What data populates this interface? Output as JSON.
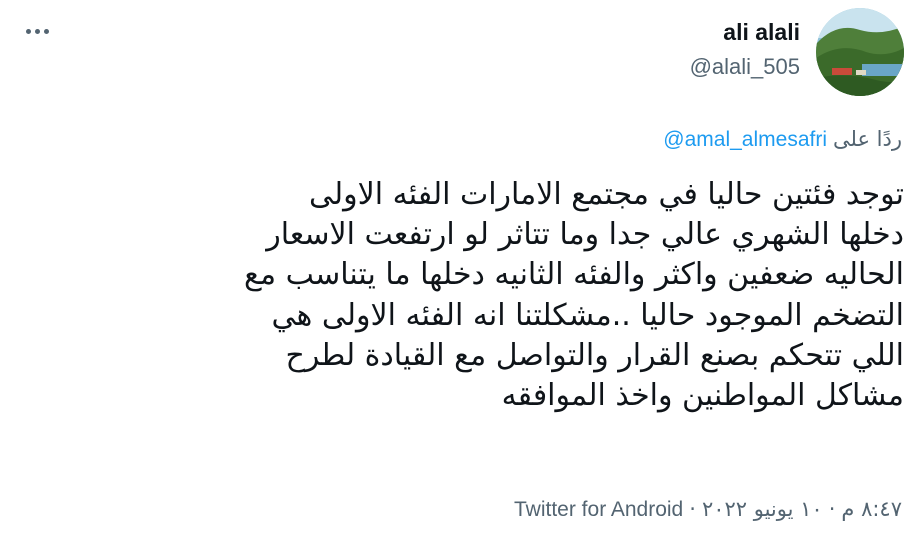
{
  "user": {
    "display_name": "ali alali",
    "handle": "@alali_505"
  },
  "reply": {
    "label": "ردًا على",
    "mention": "@amal_almesafri"
  },
  "tweet": {
    "lines": [
      "توجد فئتين حاليا في مجتمع الامارات الفئه الاولى",
      "دخلها الشهري عالي جدا وما تتاثر لو ارتفعت الاسعار",
      "الحاليه ضعفين واكثر والفئه الثانيه دخلها ما يتناسب مع",
      "التضخم الموجود حاليا ..مشكلتنا انه الفئه الاولى هي",
      "اللي تتحكم بصنع القرار والتواصل مع القيادة لطرح",
      "مشاكل المواطنين واخذ الموافقه"
    ]
  },
  "meta": {
    "time": "٨:٤٧ م",
    "date": "١٠ يونيو ٢٠٢٢",
    "separator": "·",
    "source": "Twitter for Android"
  },
  "icons": {
    "more": "more-horizontal-icon",
    "avatar": "landscape-avatar"
  },
  "colors": {
    "text": "#0f1419",
    "secondary": "#536471",
    "link": "#1d9bf0"
  }
}
